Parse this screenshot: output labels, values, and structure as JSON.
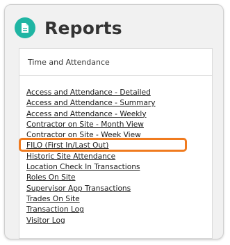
{
  "accent_color": "#1fb5a3",
  "highlight_color": "#f07b1f",
  "header": {
    "title": "Reports",
    "icon": "document-icon"
  },
  "panel": {
    "heading": "Time and Attendance",
    "links": [
      "Access and Attendance - Detailed",
      "Access and Attendance - Summary",
      "Access and Attendance - Weekly",
      "Contractor on Site - Month View",
      "Contractor on Site - Week View",
      "FILO (First In/Last Out)",
      "Historic Site Attendance",
      "Location Check In Transactions",
      "Roles On Site",
      "Supervisor App Transactions",
      "Trades On Site",
      "Transaction Log",
      "Visitor Log"
    ],
    "highlighted_link": "FILO (First In/Last Out)"
  }
}
